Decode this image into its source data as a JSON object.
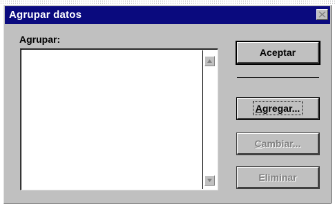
{
  "window": {
    "title": "Agrupar datos"
  },
  "label": {
    "group_label": "Agrupar:"
  },
  "buttons": {
    "accept": "Aceptar",
    "add": "Agregar...",
    "add_mnemonic": "A",
    "add_rest": "gregar...",
    "change_mnemonic": "C",
    "change_rest": "ambiar...",
    "delete": "Eliminar"
  },
  "icons": {
    "close": "close-icon",
    "scroll_up": "arrow-up-icon",
    "scroll_down": "arrow-down-icon"
  },
  "colors": {
    "titlebar": "#0a0a7e",
    "dialog_face": "#c0c0c0",
    "disabled_text": "#808080"
  }
}
